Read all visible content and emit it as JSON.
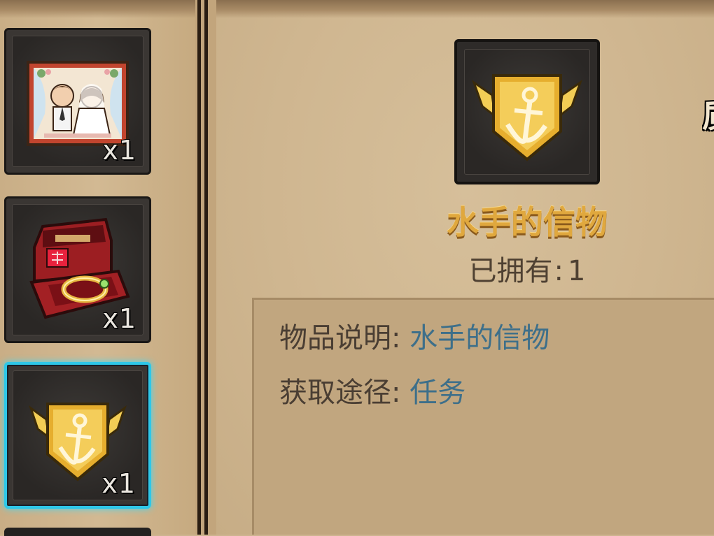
{
  "inventory": {
    "slots": [
      {
        "name": "wedding-photo",
        "icon": "wedding-photo-icon",
        "quantity": "x1",
        "selected": false
      },
      {
        "name": "ring-box",
        "icon": "ring-box-icon",
        "quantity": "x1",
        "selected": false
      },
      {
        "name": "sailor-token",
        "icon": "anchor-badge-icon",
        "quantity": "x1",
        "selected": true
      }
    ]
  },
  "detail": {
    "title": "水手的信物",
    "owned_label": "已拥有",
    "owned_sep": ":",
    "owned_count": "1",
    "corner_text": "质",
    "rows": [
      {
        "label": "物品说明",
        "sep": ":",
        "value": "水手的信物"
      },
      {
        "label": "获取途径",
        "sep": ":",
        "value": "任务"
      }
    ]
  },
  "colors": {
    "parchment": "#cdb48f",
    "title_gold": "#e0a83e",
    "value_blue": "#3d6f8a",
    "selected_border": "#2ec7e8"
  }
}
